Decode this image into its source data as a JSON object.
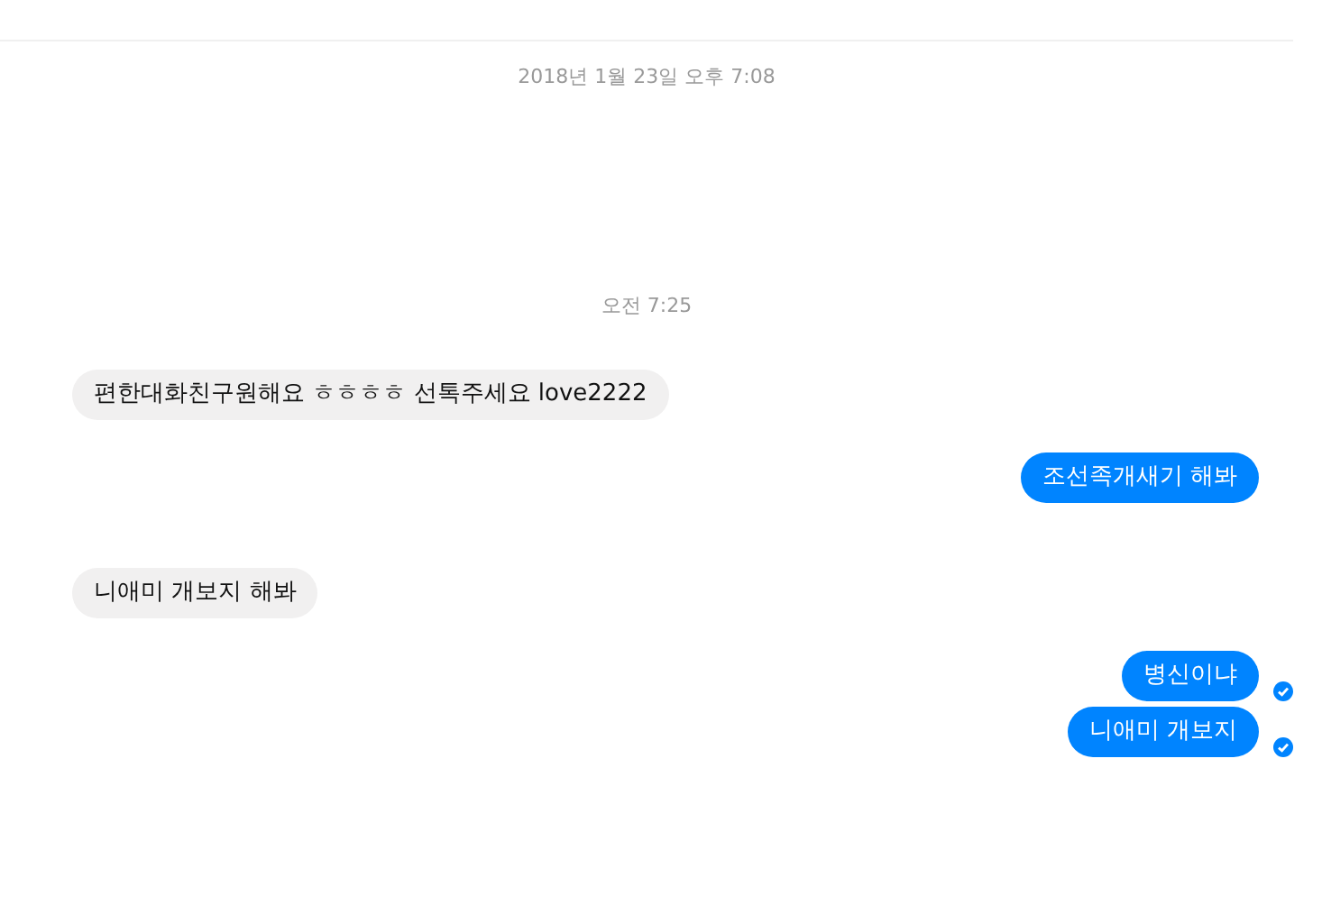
{
  "messages": [
    {
      "kind": "timestamp",
      "text": "2018년 1월 23일 오후 7:08"
    },
    {
      "kind": "timestamp",
      "text": "오전 7:25"
    },
    {
      "kind": "incoming",
      "text": "편한대화친구원해요 ㅎㅎㅎㅎ 선톡주세요 love2222"
    },
    {
      "kind": "outgoing",
      "text": "조선족개새기 해봐",
      "delivered": false
    },
    {
      "kind": "incoming",
      "text": "니애미 개보지 해봐"
    },
    {
      "kind": "outgoing",
      "text": "병신이냐",
      "delivered": true
    },
    {
      "kind": "outgoing",
      "text": "니애미 개보지",
      "delivered": true
    }
  ]
}
